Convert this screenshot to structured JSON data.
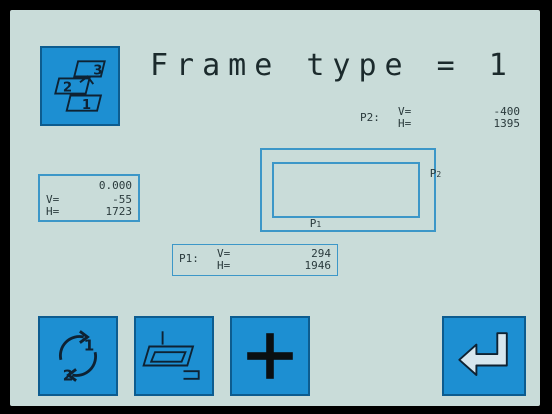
{
  "title": "Frame type = 1",
  "frame_type_icon": {
    "labels": [
      "3",
      "2",
      "1"
    ]
  },
  "p2_readout": {
    "label": "P2:",
    "v_label": "V=",
    "v_value": "-400",
    "h_label": "H=",
    "h_value": "1395"
  },
  "left_readout": {
    "top": "0.000",
    "v_label": "V=",
    "v_value": "-55",
    "h_label": "H=",
    "h_value": "1723"
  },
  "p1_readout": {
    "label": "P1:",
    "v_label": "V=",
    "v_value": "294",
    "h_label": "H=",
    "h_value": "1946"
  },
  "diagram": {
    "p1_label": "P",
    "p1_sub": "1",
    "p2_label": "P",
    "p2_sub": "2"
  },
  "toolbar": {
    "swap_labels": [
      "1",
      "2"
    ],
    "add_symbol": "+"
  }
}
